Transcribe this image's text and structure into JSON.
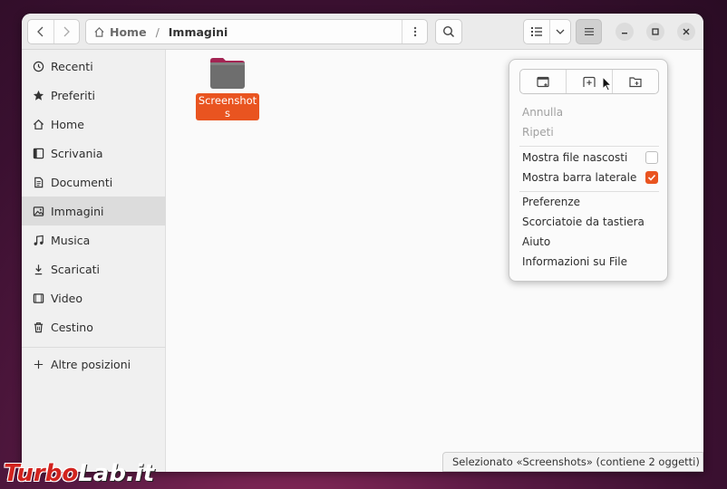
{
  "header": {
    "breadcrumb_home": "Home",
    "breadcrumb_separator": "/",
    "breadcrumb_current": "Immagini"
  },
  "sidebar": {
    "items": [
      {
        "label": "Recenti",
        "icon": "clock-icon"
      },
      {
        "label": "Preferiti",
        "icon": "star-icon"
      },
      {
        "label": "Home",
        "icon": "home-icon"
      },
      {
        "label": "Scrivania",
        "icon": "desktop-icon"
      },
      {
        "label": "Documenti",
        "icon": "document-icon"
      },
      {
        "label": "Immagini",
        "icon": "image-icon",
        "selected": true
      },
      {
        "label": "Musica",
        "icon": "music-icon"
      },
      {
        "label": "Scaricati",
        "icon": "download-icon"
      },
      {
        "label": "Video",
        "icon": "video-icon"
      },
      {
        "label": "Cestino",
        "icon": "trash-icon"
      }
    ],
    "other_locations": "Altre posizioni"
  },
  "content": {
    "folder_name": "Screenshots"
  },
  "menu": {
    "undo": "Annulla",
    "redo": "Ripeti",
    "show_hidden": "Mostra file nascosti",
    "show_hidden_checked": false,
    "show_sidebar": "Mostra barra laterale",
    "show_sidebar_checked": true,
    "preferences": "Preferenze",
    "shortcuts": "Scorciatoie da tastiera",
    "help": "Aiuto",
    "about": "Informazioni su File"
  },
  "status": {
    "text": "Selezionato «Screenshots» (contiene 2 oggetti)"
  },
  "watermark": {
    "part1": "Turbo",
    "part2": "Lab.it"
  },
  "colors": {
    "accent": "#e95420"
  }
}
